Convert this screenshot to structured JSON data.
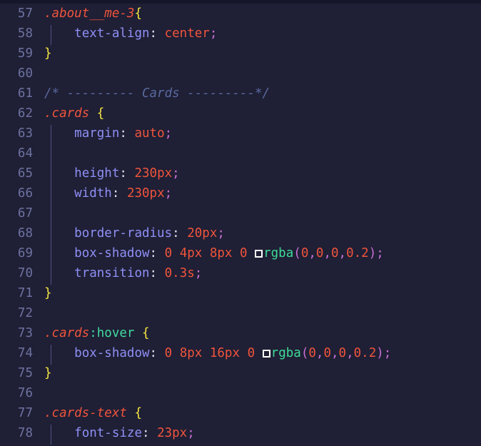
{
  "editor": {
    "theme_background": "#1f1f35",
    "gutter_color": "#6e72a1",
    "language": "css",
    "first_line": 57,
    "last_line": 78
  },
  "colors": {
    "selector": "#f0543c",
    "pseudo_class": "#41dca0",
    "brace": "#f5e642",
    "property": "#8f90f6",
    "value": "#f0543c",
    "semicolon": "#c86fd4",
    "comment": "#5a6a9e",
    "function": "#3ddc97",
    "paren": "#c86fd4",
    "punctuation": "#e8e8f2",
    "swatch_border": "#ffffff"
  },
  "lines": [
    {
      "num": "57",
      "indent_guide": false,
      "tokens": [
        {
          "text": ".about__me-3",
          "kind": "sel"
        },
        {
          "text": "{",
          "kind": "brace"
        }
      ]
    },
    {
      "num": "58",
      "indent_guide": true,
      "tokens": [
        {
          "text": "    ",
          "kind": "plain"
        },
        {
          "text": "text-align",
          "kind": "prop"
        },
        {
          "text": ":",
          "kind": "colon"
        },
        {
          "text": " ",
          "kind": "plain"
        },
        {
          "text": "center",
          "kind": "val"
        },
        {
          "text": ";",
          "kind": "semi"
        }
      ]
    },
    {
      "num": "59",
      "indent_guide": false,
      "tokens": [
        {
          "text": "}",
          "kind": "brace"
        }
      ]
    },
    {
      "num": "60",
      "indent_guide": false,
      "tokens": []
    },
    {
      "num": "61",
      "indent_guide": false,
      "tokens": [
        {
          "text": "/* --------- Cards ---------*/",
          "kind": "comment"
        }
      ]
    },
    {
      "num": "62",
      "indent_guide": false,
      "tokens": [
        {
          "text": ".cards",
          "kind": "sel"
        },
        {
          "text": " ",
          "kind": "plain"
        },
        {
          "text": "{",
          "kind": "brace"
        }
      ]
    },
    {
      "num": "63",
      "indent_guide": true,
      "tokens": [
        {
          "text": "    ",
          "kind": "plain"
        },
        {
          "text": "margin",
          "kind": "prop"
        },
        {
          "text": ":",
          "kind": "colon"
        },
        {
          "text": " ",
          "kind": "plain"
        },
        {
          "text": "auto",
          "kind": "val"
        },
        {
          "text": ";",
          "kind": "semi"
        }
      ]
    },
    {
      "num": "64",
      "indent_guide": true,
      "tokens": []
    },
    {
      "num": "65",
      "indent_guide": true,
      "tokens": [
        {
          "text": "    ",
          "kind": "plain"
        },
        {
          "text": "height",
          "kind": "prop"
        },
        {
          "text": ":",
          "kind": "colon"
        },
        {
          "text": " ",
          "kind": "plain"
        },
        {
          "text": "230px",
          "kind": "num"
        },
        {
          "text": ";",
          "kind": "semi"
        }
      ]
    },
    {
      "num": "66",
      "indent_guide": true,
      "tokens": [
        {
          "text": "    ",
          "kind": "plain"
        },
        {
          "text": "width",
          "kind": "prop"
        },
        {
          "text": ":",
          "kind": "colon"
        },
        {
          "text": " ",
          "kind": "plain"
        },
        {
          "text": "230px",
          "kind": "num"
        },
        {
          "text": ";",
          "kind": "semi"
        }
      ]
    },
    {
      "num": "67",
      "indent_guide": true,
      "tokens": []
    },
    {
      "num": "68",
      "indent_guide": true,
      "tokens": [
        {
          "text": "    ",
          "kind": "plain"
        },
        {
          "text": "border-radius",
          "kind": "prop"
        },
        {
          "text": ":",
          "kind": "colon"
        },
        {
          "text": " ",
          "kind": "plain"
        },
        {
          "text": "20px",
          "kind": "num"
        },
        {
          "text": ";",
          "kind": "semi"
        }
      ]
    },
    {
      "num": "69",
      "indent_guide": true,
      "tokens": [
        {
          "text": "    ",
          "kind": "plain"
        },
        {
          "text": "box-shadow",
          "kind": "prop"
        },
        {
          "text": ":",
          "kind": "colon"
        },
        {
          "text": " ",
          "kind": "plain"
        },
        {
          "text": "0",
          "kind": "num"
        },
        {
          "text": " ",
          "kind": "plain"
        },
        {
          "text": "4px",
          "kind": "num"
        },
        {
          "text": " ",
          "kind": "plain"
        },
        {
          "text": "8px",
          "kind": "num"
        },
        {
          "text": " ",
          "kind": "plain"
        },
        {
          "text": "0",
          "kind": "num"
        },
        {
          "text": " ",
          "kind": "plain"
        },
        {
          "text": "",
          "kind": "swatch"
        },
        {
          "text": "rgba",
          "kind": "func"
        },
        {
          "text": "(",
          "kind": "paren"
        },
        {
          "text": "0",
          "kind": "num"
        },
        {
          "text": ",",
          "kind": "comma"
        },
        {
          "text": "0",
          "kind": "num"
        },
        {
          "text": ",",
          "kind": "comma"
        },
        {
          "text": "0",
          "kind": "num"
        },
        {
          "text": ",",
          "kind": "comma"
        },
        {
          "text": "0.2",
          "kind": "num"
        },
        {
          "text": ")",
          "kind": "paren"
        },
        {
          "text": ";",
          "kind": "semi"
        }
      ]
    },
    {
      "num": "70",
      "indent_guide": true,
      "tokens": [
        {
          "text": "    ",
          "kind": "plain"
        },
        {
          "text": "transition",
          "kind": "prop"
        },
        {
          "text": ":",
          "kind": "colon"
        },
        {
          "text": " ",
          "kind": "plain"
        },
        {
          "text": "0.3s",
          "kind": "num"
        },
        {
          "text": ";",
          "kind": "semi"
        }
      ]
    },
    {
      "num": "71",
      "indent_guide": false,
      "tokens": [
        {
          "text": "}",
          "kind": "brace"
        }
      ]
    },
    {
      "num": "72",
      "indent_guide": false,
      "tokens": []
    },
    {
      "num": "73",
      "indent_guide": false,
      "tokens": [
        {
          "text": ".cards",
          "kind": "sel"
        },
        {
          "text": ":hover",
          "kind": "pseudo"
        },
        {
          "text": " ",
          "kind": "plain"
        },
        {
          "text": "{",
          "kind": "brace"
        }
      ]
    },
    {
      "num": "74",
      "indent_guide": true,
      "tokens": [
        {
          "text": "    ",
          "kind": "plain"
        },
        {
          "text": "box-shadow",
          "kind": "prop"
        },
        {
          "text": ":",
          "kind": "colon"
        },
        {
          "text": " ",
          "kind": "plain"
        },
        {
          "text": "0",
          "kind": "num"
        },
        {
          "text": " ",
          "kind": "plain"
        },
        {
          "text": "8px",
          "kind": "num"
        },
        {
          "text": " ",
          "kind": "plain"
        },
        {
          "text": "16px",
          "kind": "num"
        },
        {
          "text": " ",
          "kind": "plain"
        },
        {
          "text": "0",
          "kind": "num"
        },
        {
          "text": " ",
          "kind": "plain"
        },
        {
          "text": "",
          "kind": "swatch"
        },
        {
          "text": "rgba",
          "kind": "func"
        },
        {
          "text": "(",
          "kind": "paren"
        },
        {
          "text": "0",
          "kind": "num"
        },
        {
          "text": ",",
          "kind": "comma"
        },
        {
          "text": "0",
          "kind": "num"
        },
        {
          "text": ",",
          "kind": "comma"
        },
        {
          "text": "0",
          "kind": "num"
        },
        {
          "text": ",",
          "kind": "comma"
        },
        {
          "text": "0.2",
          "kind": "num"
        },
        {
          "text": ")",
          "kind": "paren"
        },
        {
          "text": ";",
          "kind": "semi"
        }
      ]
    },
    {
      "num": "75",
      "indent_guide": false,
      "tokens": [
        {
          "text": "}",
          "kind": "brace"
        }
      ]
    },
    {
      "num": "76",
      "indent_guide": false,
      "tokens": []
    },
    {
      "num": "77",
      "indent_guide": false,
      "tokens": [
        {
          "text": ".cards-text",
          "kind": "sel"
        },
        {
          "text": " ",
          "kind": "plain"
        },
        {
          "text": "{",
          "kind": "brace"
        }
      ]
    },
    {
      "num": "78",
      "indent_guide": true,
      "tokens": [
        {
          "text": "    ",
          "kind": "plain"
        },
        {
          "text": "font-size",
          "kind": "prop"
        },
        {
          "text": ":",
          "kind": "colon"
        },
        {
          "text": " ",
          "kind": "plain"
        },
        {
          "text": "23px",
          "kind": "num"
        },
        {
          "text": ";",
          "kind": "semi"
        }
      ]
    }
  ]
}
